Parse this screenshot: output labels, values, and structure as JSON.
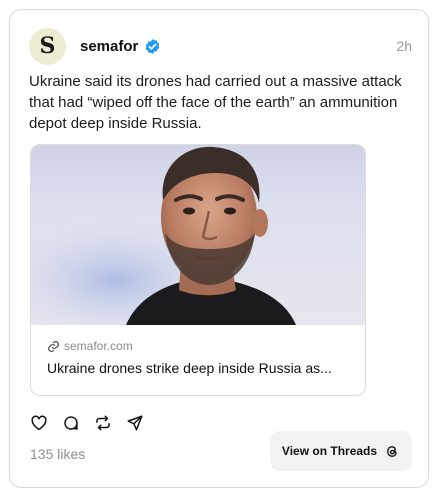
{
  "post": {
    "avatar_letter": "S",
    "username": "semafor",
    "time": "2h",
    "text": "Ukraine said its drones had carried out a massive attack that had “wiped off the face of the earth” an ammunition depot deep inside Russia."
  },
  "link_card": {
    "domain": "semafor.com",
    "title": "Ukraine drones strike deep inside Russia as..."
  },
  "engagement": {
    "likes": "135 likes",
    "view_button": "View on Threads"
  },
  "colors": {
    "accent_verified": "#1d9bf0",
    "avatar_bg": "#eeebd3"
  },
  "icons": [
    "verified-icon",
    "heart-icon",
    "comment-icon",
    "repost-icon",
    "share-icon",
    "link-icon",
    "threads-icon"
  ]
}
